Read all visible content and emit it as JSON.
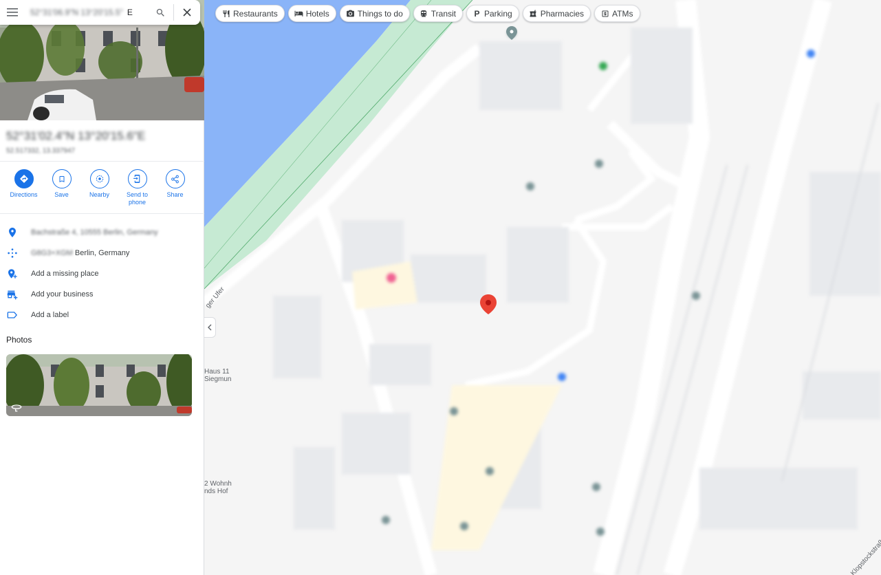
{
  "search": {
    "value_obscured": "52°31'06.9\"N 13°20'15.5\"",
    "value_suffix": "E"
  },
  "filter_chips": [
    {
      "label": "Restaurants",
      "icon": "fork-knife-icon"
    },
    {
      "label": "Hotels",
      "icon": "bed-icon"
    },
    {
      "label": "Things to do",
      "icon": "camera-icon"
    },
    {
      "label": "Transit",
      "icon": "train-icon"
    },
    {
      "label": "Parking",
      "icon": "parking-icon"
    },
    {
      "label": "Pharmacies",
      "icon": "pharmacy-icon"
    },
    {
      "label": "ATMs",
      "icon": "atm-icon"
    }
  ],
  "place": {
    "coords_title": "52°31'02.4\"N 13°20'15.6\"E",
    "coords_decimal": "52.517332, 13.337947"
  },
  "actions": [
    {
      "label": "Directions",
      "icon": "directions-icon"
    },
    {
      "label": "Save",
      "icon": "bookmark-icon"
    },
    {
      "label": "Nearby",
      "icon": "nearby-icon"
    },
    {
      "label": "Send to phone",
      "icon": "send-to-phone-icon"
    },
    {
      "label": "Share",
      "icon": "share-icon"
    }
  ],
  "info": {
    "address": "Bachstraße 4, 10555 Berlin, Germany",
    "plus_code_obscured": "G8G3+XGM",
    "plus_code_suffix": "Berlin, Germany",
    "add_missing_place": "Add a missing place",
    "add_business": "Add your business",
    "add_label": "Add a label"
  },
  "photos_heading": "Photos",
  "map": {
    "street_label_1": "ger Ufer",
    "poi_label_1a": "Haus 11",
    "poi_label_1b": "Siegmun",
    "poi_label_2a": "2 Wohnh",
    "poi_label_2b": "nds Hof",
    "street_label_2": "Klopstockstraß",
    "pin_color": "#ea4335",
    "water_color": "#8ab4f8",
    "park_color": "#c6ead3"
  }
}
